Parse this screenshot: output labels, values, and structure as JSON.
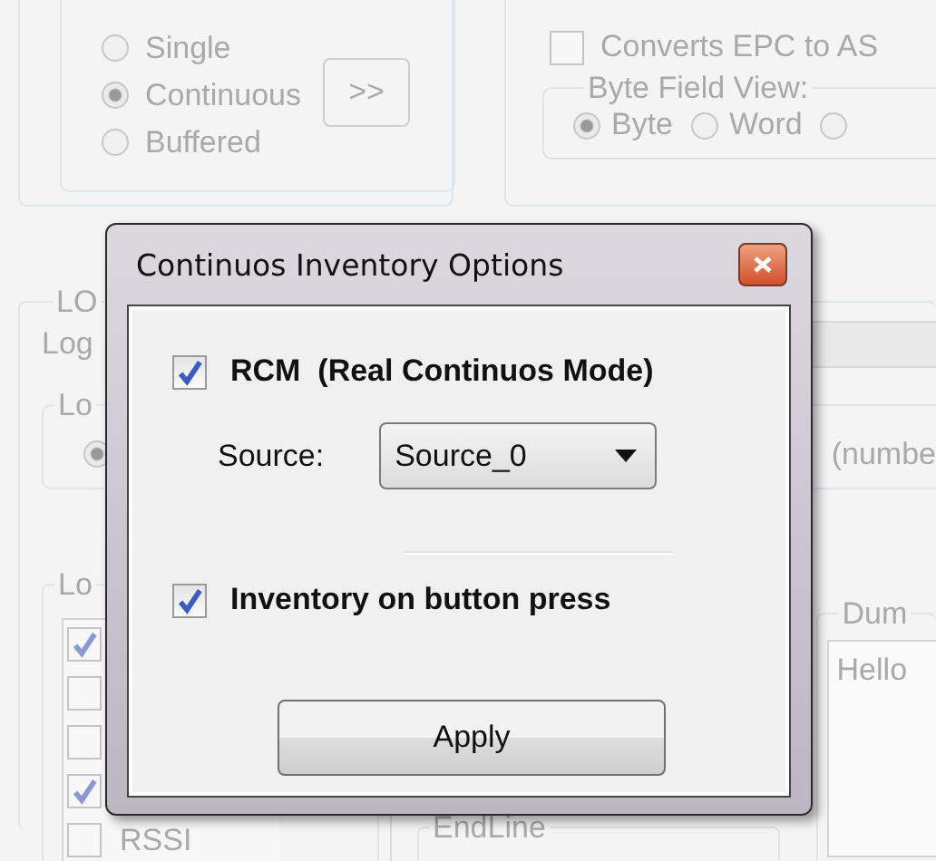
{
  "background": {
    "read_mode": {
      "options": [
        {
          "label": "Single",
          "selected": false
        },
        {
          "label": "Continuous",
          "selected": true
        },
        {
          "label": "Buffered",
          "selected": false
        }
      ],
      "more_button": ">>"
    },
    "convert_epc": {
      "label": "Converts EPC to AS",
      "checked": false
    },
    "byte_field_view": {
      "title": "Byte Field View:",
      "options": [
        {
          "label": "Byte",
          "selected": true
        },
        {
          "label": "Word",
          "selected": false
        },
        {
          "selected": false
        }
      ]
    },
    "log_group": {
      "title": "LO",
      "label": "Log"
    },
    "log_mode": {
      "title": "Lo",
      "selected": true,
      "option_text": "(numbe"
    },
    "log_fields": {
      "title": "Lo",
      "items": [
        {
          "checked": true
        },
        {
          "checked": false
        },
        {
          "checked": false
        },
        {
          "checked": true
        },
        {
          "label": "RSSI",
          "checked": false
        }
      ]
    },
    "endline": {
      "title": "EndLine"
    },
    "dump": {
      "title": "Dum",
      "text": "Hello"
    }
  },
  "dialog": {
    "title": "Continuos Inventory Options",
    "rcm": {
      "label": "RCM  (Real Continuos Mode)",
      "checked": true
    },
    "source": {
      "label": "Source:",
      "value": "Source_0"
    },
    "inventory_on_button": {
      "label": "Inventory on button press",
      "checked": true
    },
    "apply": "Apply"
  }
}
